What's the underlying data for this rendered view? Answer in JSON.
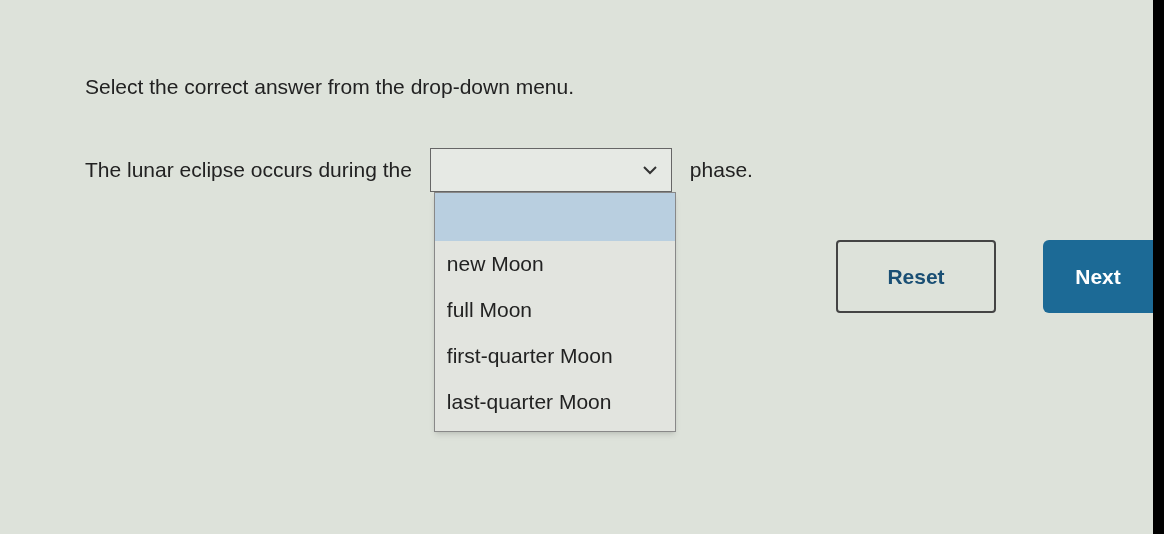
{
  "prompt": "Select the correct answer from the drop-down menu.",
  "sentence": {
    "before": "The lunar eclipse occurs during the",
    "after": "phase."
  },
  "dropdown": {
    "expanded": true,
    "blank_option_highlighted": true,
    "options": [
      {
        "label": "new Moon",
        "selected": false
      },
      {
        "label": "full Moon",
        "selected": false
      },
      {
        "label": "first-quarter Moon",
        "selected": false
      },
      {
        "label": "last-quarter Moon",
        "selected": false
      }
    ]
  },
  "buttons": [
    {
      "label": "Reset",
      "kind": "outline"
    },
    {
      "label": "Next",
      "kind": "primary"
    }
  ]
}
